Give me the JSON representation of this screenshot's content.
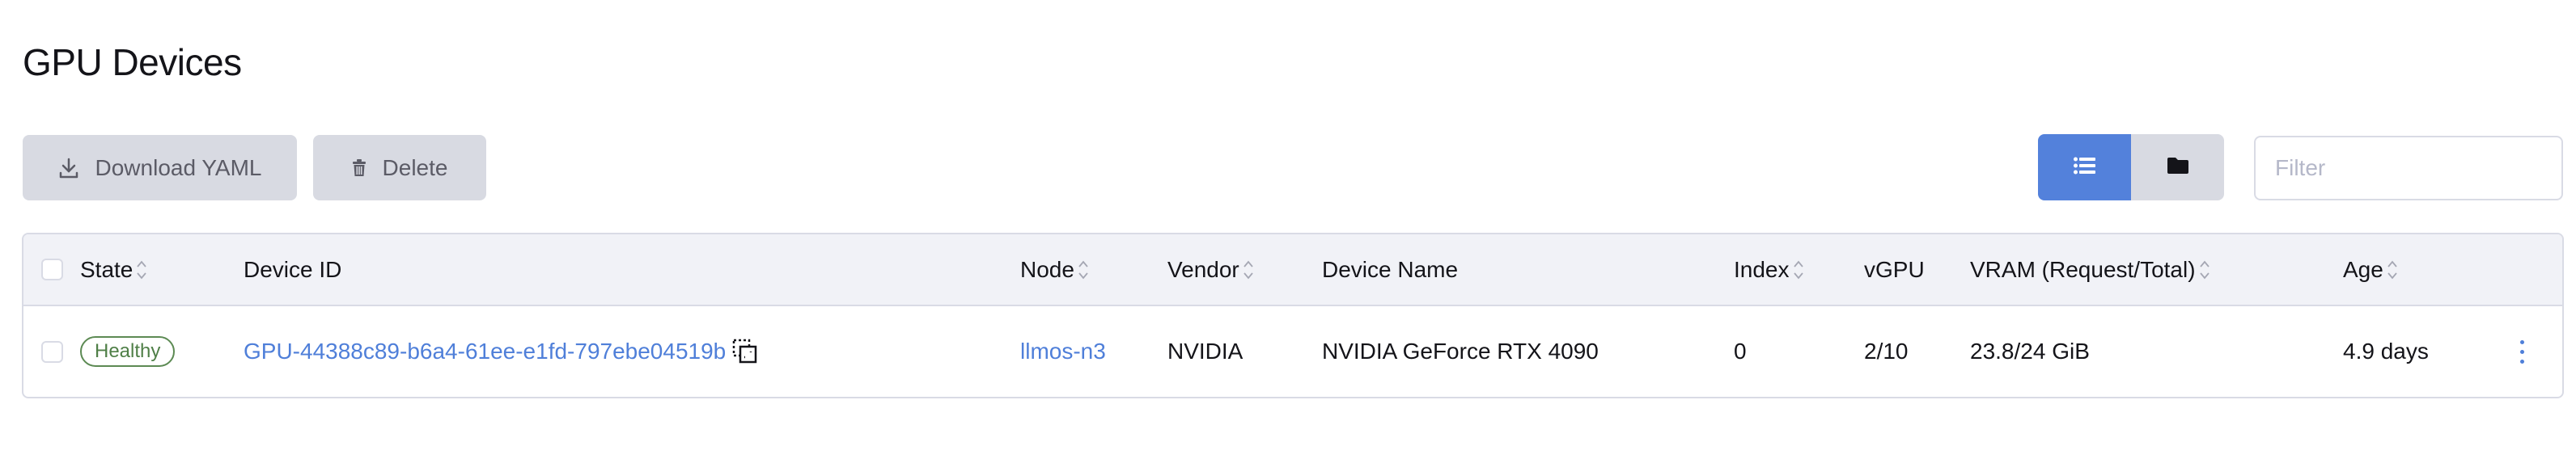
{
  "page": {
    "title": "GPU Devices"
  },
  "toolbar": {
    "download_label": "Download YAML",
    "download_icon": "download-icon",
    "delete_label": "Delete",
    "delete_icon": "trash-icon",
    "view_list_icon": "list-icon",
    "view_folder_icon": "folder-icon",
    "active_view": "list",
    "filter_placeholder": "Filter",
    "filter_value": ""
  },
  "colors": {
    "accent": "#5381db",
    "link": "#4f7fd9",
    "healthy": "#4f7f47",
    "button_bg": "#d8dae2",
    "header_bg": "#f1f2f7"
  },
  "table": {
    "columns": [
      {
        "key": "state",
        "label": "State",
        "sortable": true
      },
      {
        "key": "device_id",
        "label": "Device ID",
        "sortable": false
      },
      {
        "key": "node",
        "label": "Node",
        "sortable": true
      },
      {
        "key": "vendor",
        "label": "Vendor",
        "sortable": true
      },
      {
        "key": "device_name",
        "label": "Device Name",
        "sortable": false
      },
      {
        "key": "index",
        "label": "Index",
        "sortable": true
      },
      {
        "key": "vgpu",
        "label": "vGPU",
        "sortable": false
      },
      {
        "key": "vram",
        "label": "VRAM (Request/Total)",
        "sortable": true
      },
      {
        "key": "age",
        "label": "Age",
        "sortable": true
      }
    ],
    "rows": [
      {
        "state": "Healthy",
        "device_id": "GPU-44388c89-b6a4-61ee-e1fd-797ebe04519b",
        "node": "llmos-n3",
        "vendor": "NVIDIA",
        "device_name": "NVIDIA GeForce RTX 4090",
        "index": "0",
        "vgpu": "2/10",
        "vram": "23.8/24 GiB",
        "age": "4.9 days"
      }
    ]
  }
}
